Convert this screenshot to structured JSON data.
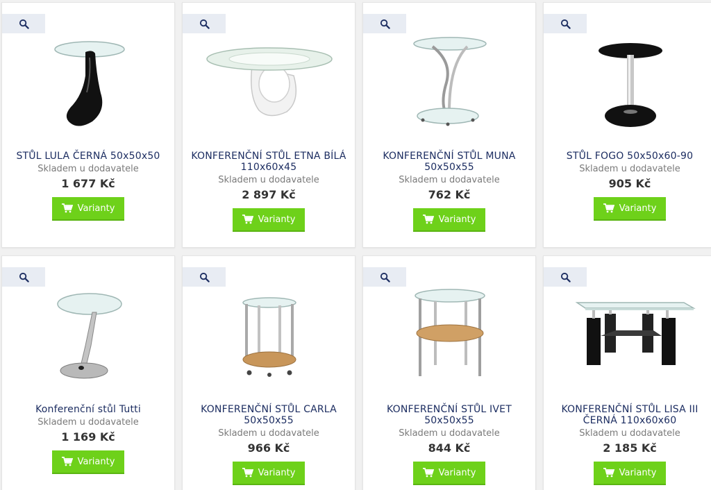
{
  "products": [
    {
      "title": "STŮL LULA ČERNÁ 50x50x50",
      "stock": "Skladem u dodavatele",
      "price": "1 677 Kč",
      "button": "Varianty"
    },
    {
      "title": "KONFERENČNÍ STŮL ETNA BÍLÁ 110x60x45",
      "stock": "Skladem u dodavatele",
      "price": "2 897 Kč",
      "button": "Varianty"
    },
    {
      "title": "KONFERENČNÍ STŮL MUNA 50x50x55",
      "stock": "Skladem u dodavatele",
      "price": "762 Kč",
      "button": "Varianty"
    },
    {
      "title": "STŮL FOGO 50x50x60-90",
      "stock": "Skladem u dodavatele",
      "price": "905 Kč",
      "button": "Varianty"
    },
    {
      "title": "Konferenční stůl Tutti",
      "stock": "Skladem u dodavatele",
      "price": "1 169 Kč",
      "button": "Varianty"
    },
    {
      "title": "KONFERENČNÍ STŮL CARLA 50x50x55",
      "stock": "Skladem u dodavatele",
      "price": "966 Kč",
      "button": "Varianty"
    },
    {
      "title": "KONFERENČNÍ STŮL IVET 50x50x55",
      "stock": "Skladem u dodavatele",
      "price": "844 Kč",
      "button": "Varianty"
    },
    {
      "title": "KONFERENČNÍ STŮL LISA III ČERNÁ 110x60x60",
      "stock": "Skladem u dodavatele",
      "price": "2 185 Kč",
      "button": "Varianty"
    }
  ],
  "icons": {
    "zoom": "search-icon",
    "cart": "cart-icon"
  },
  "colors": {
    "title": "#1c2d61",
    "button": "#6ed11a",
    "zoom_bg": "#e8ecf3",
    "price": "#333333"
  }
}
